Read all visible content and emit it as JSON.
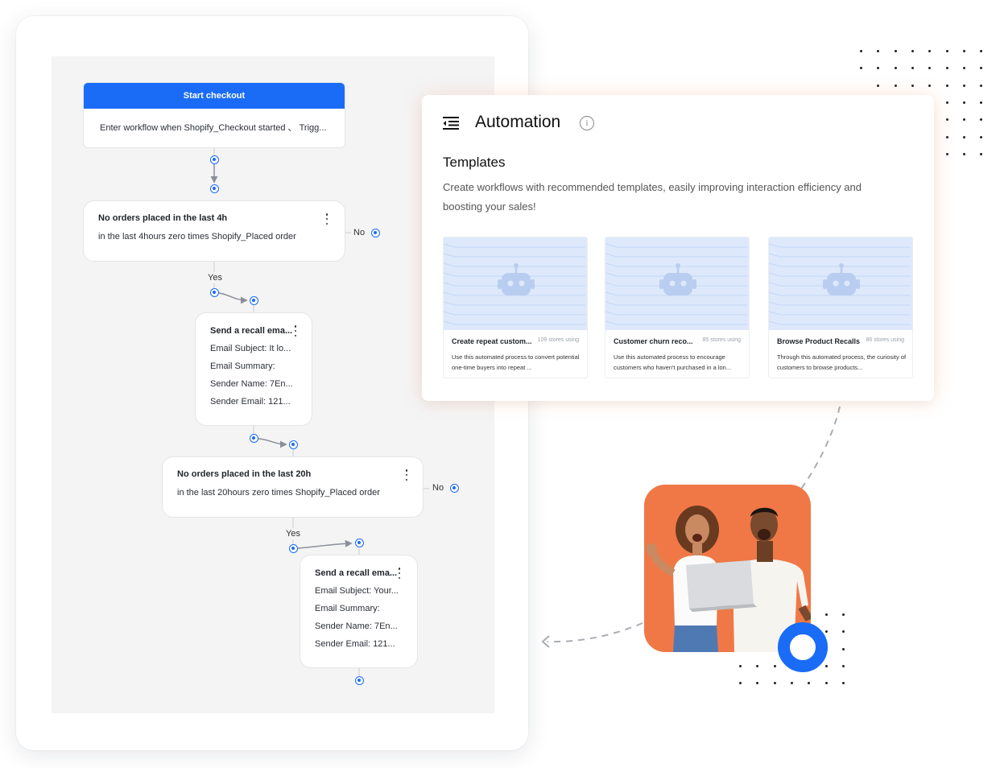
{
  "workflow": {
    "start": {
      "title": "Start checkout",
      "description": "Enter workflow when Shopify_Checkout started 、 Trigg..."
    },
    "condition_1": {
      "title": "No orders placed in the last 4h",
      "description": "in the last 4hours zero times Shopify_Placed order",
      "no_label": "No",
      "yes_label": "Yes"
    },
    "email_1": {
      "title": "Send a recall ema...",
      "subject": "Email Subject: It lo...",
      "summary": "Email Summary:",
      "sender_name": "Sender Name: 7En...",
      "sender_email": "Sender Email: 121..."
    },
    "condition_2": {
      "title": "No orders placed in the last 20h",
      "description": "in the last 20hours zero times Shopify_Placed order",
      "no_label": "No",
      "yes_label": "Yes"
    },
    "email_2": {
      "title": "Send a recall ema...",
      "subject": "Email Subject: Your...",
      "summary": "Email Summary:",
      "sender_name": "Sender Name: 7En...",
      "sender_email": "Sender Email: 121..."
    }
  },
  "automation": {
    "title": "Automation",
    "info_icon": "info-icon",
    "templates_heading": "Templates",
    "templates_description": "Create workflows with recommended templates, easily improving interaction efficiency and boosting your sales!",
    "templates": [
      {
        "name": "Create repeat custom...",
        "count": "109 stores using",
        "description": "Use this automated process to convert potential one-time buyers into repeat ..."
      },
      {
        "name": "Customer churn reco...",
        "count": "85 stores using",
        "description": "Use this automated process to encourage customers who haven't purchased in a lon..."
      },
      {
        "name": "Browse Product Recalls",
        "count": "86 stores using",
        "description": "Through this automated process, the curiosity of customers to browse products..."
      }
    ]
  },
  "colors": {
    "primary": "#1a6cf6",
    "photo_background": "#f07846",
    "canvas_background": "#f4f4f5"
  }
}
